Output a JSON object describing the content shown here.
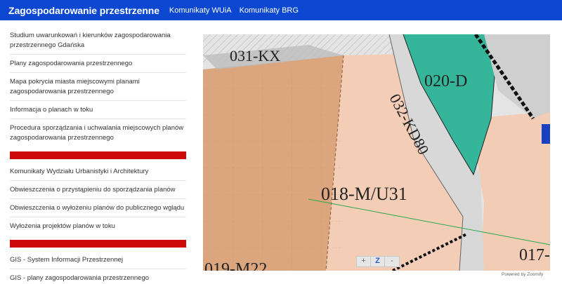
{
  "header": {
    "brand": "Zagospodarowanie przestrzenne",
    "nav": [
      "Komunikaty WUiA",
      "Komunikaty BRG"
    ]
  },
  "sidebar": {
    "group1": [
      {
        "label": "Studium uwarunkowań i kierunków zagospodarowania przestrzennego Gdańska"
      },
      {
        "label": "Plany zagospodarowania przestrzennego"
      },
      {
        "label": "Mapa pokrycia miasta miejscowymi planami zagospodarowania przestrzennego"
      },
      {
        "label": "Informacja o planach w toku"
      },
      {
        "label": "Procedura sporządzania i uchwalania miejscowych planów zagospodarowania przestrzennego"
      }
    ],
    "group2": [
      {
        "label": "Komunikaty Wydziału Urbanistyki i Architektury"
      },
      {
        "label": "Obwieszczenia o przystąpieniu do sporządzania planów"
      },
      {
        "label": "Obwieszczenia o wyłożeniu planów do publicznego wglądu"
      },
      {
        "label": "Wyłożenia projektów planów w toku"
      }
    ],
    "group3": [
      {
        "label": "GIS - System Informacji Przestrzennej"
      },
      {
        "label": "GIS - plany zagospodarowania przestrzennego"
      }
    ]
  },
  "map": {
    "labels": {
      "zone_031": "031-KX",
      "zone_020": "020-D",
      "zone_032": "032-KD80",
      "zone_018": "018-M/U31",
      "zone_019": "019-M22",
      "zone_017": "017-"
    },
    "colors": {
      "orange_zone": "#dba67e",
      "light_zone": "#f3cdb6",
      "green_zone": "#35b59a",
      "road": "#d6d6d6"
    },
    "zoom": {
      "in": "+",
      "z": "Z",
      "out": "-"
    },
    "powered_by": "Powered by Zoomify"
  }
}
